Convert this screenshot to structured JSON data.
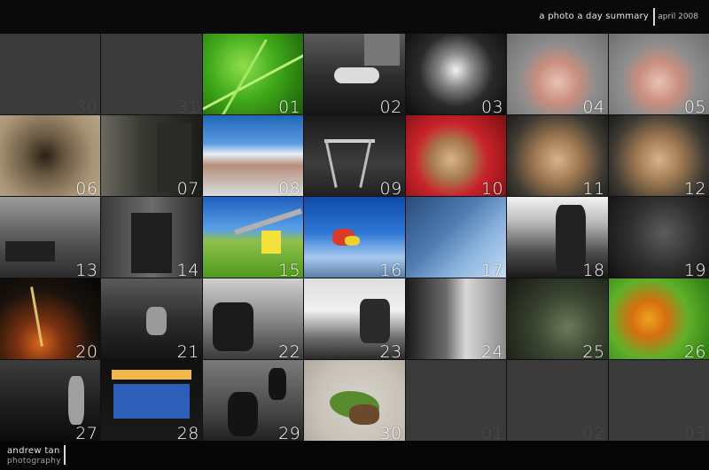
{
  "header": {
    "title": "a photo a day summary",
    "month": "april 2008"
  },
  "footer": {
    "brand_line1": "andrew tan",
    "brand_line2": "photography"
  },
  "calendar": {
    "cells": [
      {
        "label": "30",
        "photo": false
      },
      {
        "label": "31",
        "photo": false
      },
      {
        "label": "01",
        "photo": true,
        "subject": "green-leaf"
      },
      {
        "label": "02",
        "photo": true,
        "subject": "parked-car"
      },
      {
        "label": "03",
        "photo": true,
        "subject": "water-splash"
      },
      {
        "label": "04",
        "photo": true,
        "subject": "baby-rodent"
      },
      {
        "label": "05",
        "photo": true,
        "subject": "baby-rodent"
      },
      {
        "label": "06",
        "photo": true,
        "subject": "jumping-spider"
      },
      {
        "label": "07",
        "photo": true,
        "subject": "doorway"
      },
      {
        "label": "08",
        "photo": true,
        "subject": "blue-sky-trees"
      },
      {
        "label": "09",
        "photo": true,
        "subject": "structure"
      },
      {
        "label": "10",
        "photo": true,
        "subject": "hamster-red"
      },
      {
        "label": "11",
        "photo": true,
        "subject": "hamster"
      },
      {
        "label": "12",
        "photo": true,
        "subject": "hamster"
      },
      {
        "label": "13",
        "photo": true,
        "subject": "street-cart"
      },
      {
        "label": "14",
        "photo": true,
        "subject": "gate"
      },
      {
        "label": "15",
        "photo": true,
        "subject": "field-sign"
      },
      {
        "label": "16",
        "photo": true,
        "subject": "overpass-sky"
      },
      {
        "label": "17",
        "photo": true,
        "subject": "building-blue"
      },
      {
        "label": "18",
        "photo": true,
        "subject": "statue"
      },
      {
        "label": "19",
        "photo": true,
        "subject": "carving"
      },
      {
        "label": "20",
        "photo": true,
        "subject": "night-works"
      },
      {
        "label": "21",
        "photo": true,
        "subject": "seated-people"
      },
      {
        "label": "22",
        "photo": true,
        "subject": "child-bench"
      },
      {
        "label": "23",
        "photo": true,
        "subject": "person-window"
      },
      {
        "label": "24",
        "photo": true,
        "subject": "girl-waving"
      },
      {
        "label": "25",
        "photo": true,
        "subject": "foliage"
      },
      {
        "label": "26",
        "photo": true,
        "subject": "orange-insect"
      },
      {
        "label": "27",
        "photo": true,
        "subject": "photographer"
      },
      {
        "label": "28",
        "photo": true,
        "subject": "billboard"
      },
      {
        "label": "29",
        "photo": true,
        "subject": "silhouettes"
      },
      {
        "label": "30",
        "photo": true,
        "subject": "insect"
      },
      {
        "label": "01",
        "photo": false
      },
      {
        "label": "02",
        "photo": false
      },
      {
        "label": "03",
        "photo": false
      }
    ]
  }
}
